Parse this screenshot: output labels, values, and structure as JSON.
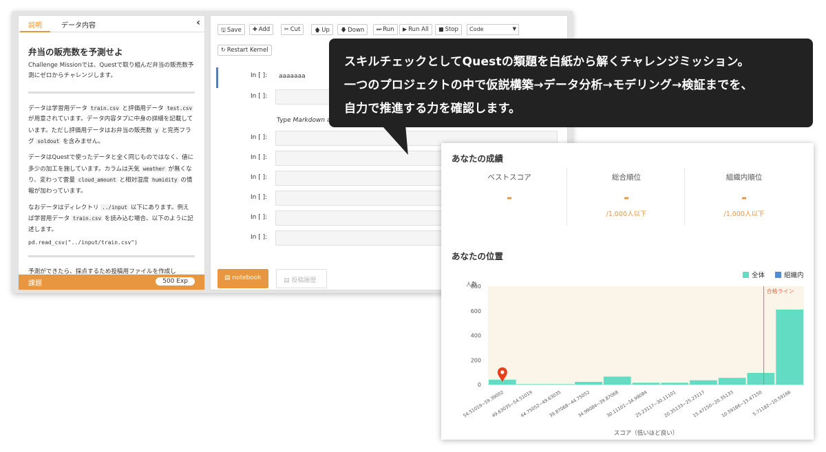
{
  "left_panel": {
    "tab_active": "説明",
    "tab_other": "データ内容",
    "close_icon": "‹",
    "title": "弁当の販売数を予測せよ",
    "intro": "Challenge Missionでは、Questで取り組んだ弁当の販売数予測にゼロからチャレンジします。",
    "p1_a": "データは学習用データ ",
    "p1_code1": "train.csv",
    "p1_b": " と評価用データ ",
    "p1_code2": "test.csv",
    "p1_c": " が用意されています。データ内容タブに中身の詳細を記載しています。ただし評価用データはお弁当の販売数 ",
    "p1_code3": "y",
    "p1_d": " と完売フラグ ",
    "p1_code4": "soldout",
    "p1_e": " を含みません。",
    "p2_a": "データはQuestで使ったデータと全く同じものではなく、値に多少の加工を施しています。カラムは天気 ",
    "p2_code1": "weather",
    "p2_b": " が無くなり、変わって雲量 ",
    "p2_code2": "cloud_amount",
    "p2_c": " と相対湿度 ",
    "p2_code3": "humidity",
    "p2_d": " の情報が加わっています。",
    "p3_a": "なおデータはディレクトリ ",
    "p3_code1": "../input",
    "p3_b": " 以下にあります。例えば学習用データ ",
    "p3_code2": "train.csv",
    "p3_c": " を読み込む場合、以下のように記述します。",
    "code_line": "pd.read_csv(\"../input/train.csv\")",
    "p4": "予測ができたら、採点するため投稿用ファイルを作成し",
    "footer_label": "課題",
    "footer_exp": "500 Exp"
  },
  "toolbar": {
    "save": "Save",
    "add": "Add",
    "cut": "Cut",
    "up": "Up",
    "down": "Down",
    "run": "Run",
    "run_all": "Run All",
    "stop": "Stop",
    "cell_type": "Code",
    "restart": "Restart Kernel"
  },
  "notebook": {
    "prompt": "In [ ]:",
    "first_cell_value": "aaaaaaa",
    "markdown_prefix": "Type ",
    "markdown_italic": "Markdown",
    "markdown_suffix": " a",
    "notebook_button": "notebook",
    "submit_button": "投稿履歴"
  },
  "callout": {
    "line1": "スキルチェックとしてQuestの類題を白紙から解くチャレンジミッション。",
    "line2": "一つのプロジェクトの中で仮説構築→データ分析→モデリング→検証までを、",
    "line3": "自力で推進する力を確認します。"
  },
  "results": {
    "title": "あなたの成績",
    "best_score_label": "ベストスコア",
    "best_score_value": "-",
    "overall_rank_label": "総合順位",
    "overall_rank_value": "-",
    "overall_rank_sub": "/1,000人以下",
    "org_rank_label": "組織内順位",
    "org_rank_value": "-",
    "org_rank_sub": "/1,000人以下",
    "position_title": "あなたの位置"
  },
  "colors": {
    "accent": "#e8963f",
    "bar_all": "#62dcc3",
    "bar_org": "#4a90d9",
    "pass_line": "#e8704a",
    "marker": "#e8401c",
    "chart_bg": "#fbf5e9"
  },
  "chart_data": {
    "type": "bar",
    "ylabel": "人数",
    "xlabel": "スコア（低いほど良い）",
    "ylim": [
      0,
      800
    ],
    "yticks": [
      0,
      200,
      400,
      600,
      800
    ],
    "categories": [
      "54.51019~59.39002",
      "49.63035~54.51019",
      "44.75052~49.63035",
      "39.87068~44.75052",
      "34.99084~39.87068",
      "30.11101~34.99084",
      "25.23117~30.11101",
      "20.35133~25.23117",
      "15.47150~20.35133",
      "10.59166~15.47150",
      "5.71182~10.59166"
    ],
    "series": [
      {
        "name": "全体",
        "values": [
          40,
          4,
          4,
          22,
          65,
          15,
          15,
          35,
          55,
          95,
          610
        ]
      },
      {
        "name": "組織内",
        "values": [
          0,
          0,
          0,
          0,
          0,
          0,
          0,
          0,
          0,
          0,
          0
        ]
      }
    ],
    "pass_line_label": "合格ライン",
    "pass_line_category_index": 9.6,
    "marker_category_index": 0,
    "legend": "top-right",
    "grid": false
  }
}
